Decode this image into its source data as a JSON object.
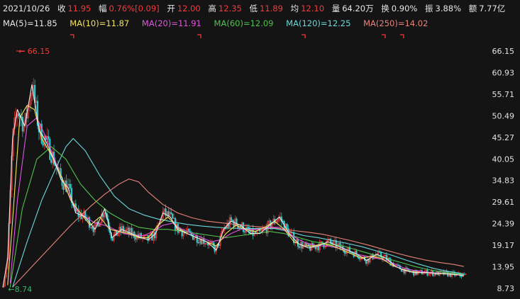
{
  "quote": {
    "date": "2021/10/26",
    "close_label": "收",
    "close": "11.95",
    "change_label": "幅",
    "change": "0.76%[0.09]",
    "open_label": "开",
    "open": "12.00",
    "high_label": "高",
    "high": "12.35",
    "low_label": "低",
    "low": "11.89",
    "avg_label": "均",
    "avg": "12.10",
    "volume_label": "量",
    "volume": "64.20万",
    "turnover_label": "换",
    "turnover": "0.90%",
    "amplitude_label": "振",
    "amplitude": "3.88%",
    "amount_label": "额",
    "amount": "7.77亿"
  },
  "ma_legend": [
    {
      "text": "MA(5)=11.85",
      "color": "#e8e8e8"
    },
    {
      "text": "MA(10)=11.87",
      "color": "#f2e35a"
    },
    {
      "text": "MA(20)=11.91",
      "color": "#e055e0"
    },
    {
      "text": "MA(60)=12.09",
      "color": "#4fc24f"
    },
    {
      "text": "MA(120)=12.25",
      "color": "#6ad8dc"
    },
    {
      "text": "MA(250)=14.02",
      "color": "#e8837a"
    }
  ],
  "colors": {
    "up": "#f23b3b",
    "down": "#30c8c8",
    "flat": "#e6e6e6",
    "background": "#141414",
    "accent": "#f23b3b",
    "low_marker": "#35b86b"
  },
  "chart_data": {
    "type": "line",
    "y_ticks": [
      "66.15",
      "60.93",
      "55.71",
      "50.49",
      "45.27",
      "40.05",
      "34.83",
      "29.61",
      "24.39",
      "19.17",
      "13.95",
      "8.73"
    ],
    "ylim": [
      8.73,
      66.15
    ],
    "grid": false,
    "max_annotation": {
      "label": "66.15",
      "x": 0.06,
      "y": 66.15
    },
    "min_annotation": {
      "label": "8.74",
      "x": 0.005,
      "y": 8.74
    },
    "event_markers": [
      0.143,
      0.405,
      0.62,
      0.785,
      0.823
    ],
    "series": [
      {
        "name": "MA(5)",
        "color": "#e8e8e8",
        "values": [
          [
            0,
            9.0
          ],
          [
            0.01,
            16
          ],
          [
            0.02,
            45
          ],
          [
            0.03,
            52
          ],
          [
            0.045,
            48
          ],
          [
            0.06,
            58
          ],
          [
            0.075,
            47
          ],
          [
            0.09,
            44
          ],
          [
            0.105,
            40
          ],
          [
            0.12,
            35
          ],
          [
            0.135,
            33
          ],
          [
            0.15,
            27
          ],
          [
            0.17,
            26
          ],
          [
            0.19,
            23
          ],
          [
            0.21,
            28
          ],
          [
            0.225,
            21
          ],
          [
            0.245,
            23
          ],
          [
            0.265,
            22
          ],
          [
            0.285,
            21
          ],
          [
            0.3,
            20.5
          ],
          [
            0.315,
            22
          ],
          [
            0.33,
            27
          ],
          [
            0.345,
            26
          ],
          [
            0.36,
            23
          ],
          [
            0.38,
            22
          ],
          [
            0.4,
            21
          ],
          [
            0.42,
            20
          ],
          [
            0.44,
            18
          ],
          [
            0.455,
            23
          ],
          [
            0.47,
            25
          ],
          [
            0.49,
            24
          ],
          [
            0.51,
            22
          ],
          [
            0.53,
            22
          ],
          [
            0.55,
            24
          ],
          [
            0.57,
            26
          ],
          [
            0.59,
            22
          ],
          [
            0.61,
            19.5
          ],
          [
            0.63,
            18.5
          ],
          [
            0.65,
            19
          ],
          [
            0.67,
            20
          ],
          [
            0.69,
            19
          ],
          [
            0.71,
            18
          ],
          [
            0.73,
            17
          ],
          [
            0.75,
            15.5
          ],
          [
            0.77,
            17
          ],
          [
            0.79,
            16
          ],
          [
            0.81,
            14
          ],
          [
            0.83,
            13
          ],
          [
            0.85,
            12.5
          ],
          [
            0.87,
            12.6
          ],
          [
            0.89,
            12.4
          ],
          [
            0.91,
            12.3
          ],
          [
            0.93,
            12.1
          ],
          [
            0.95,
            11.85
          ]
        ]
      },
      {
        "name": "MA(10)",
        "color": "#f2e35a",
        "values": [
          [
            0.01,
            9.5
          ],
          [
            0.02,
            25
          ],
          [
            0.035,
            50
          ],
          [
            0.05,
            53
          ],
          [
            0.065,
            52
          ],
          [
            0.08,
            45
          ],
          [
            0.1,
            41
          ],
          [
            0.12,
            36
          ],
          [
            0.14,
            30
          ],
          [
            0.16,
            27
          ],
          [
            0.18,
            24
          ],
          [
            0.2,
            26
          ],
          [
            0.22,
            23
          ],
          [
            0.24,
            22.5
          ],
          [
            0.26,
            22
          ],
          [
            0.28,
            21
          ],
          [
            0.3,
            21
          ],
          [
            0.32,
            24
          ],
          [
            0.34,
            26
          ],
          [
            0.36,
            23.5
          ],
          [
            0.38,
            22
          ],
          [
            0.4,
            21
          ],
          [
            0.42,
            20
          ],
          [
            0.44,
            19
          ],
          [
            0.46,
            22
          ],
          [
            0.48,
            24
          ],
          [
            0.5,
            23
          ],
          [
            0.52,
            22.5
          ],
          [
            0.54,
            23.5
          ],
          [
            0.56,
            25
          ],
          [
            0.58,
            23
          ],
          [
            0.6,
            20
          ],
          [
            0.62,
            19
          ],
          [
            0.64,
            19
          ],
          [
            0.66,
            19.5
          ],
          [
            0.68,
            19
          ],
          [
            0.7,
            18
          ],
          [
            0.72,
            17
          ],
          [
            0.74,
            16
          ],
          [
            0.76,
            16.5
          ],
          [
            0.78,
            16
          ],
          [
            0.8,
            14.5
          ],
          [
            0.82,
            13.5
          ],
          [
            0.84,
            12.8
          ],
          [
            0.86,
            12.6
          ],
          [
            0.88,
            12.5
          ],
          [
            0.9,
            12.3
          ],
          [
            0.92,
            12.2
          ],
          [
            0.95,
            11.87
          ]
        ]
      },
      {
        "name": "MA(20)",
        "color": "#e055e0",
        "values": [
          [
            0.015,
            10
          ],
          [
            0.03,
            30
          ],
          [
            0.05,
            48
          ],
          [
            0.07,
            50
          ],
          [
            0.09,
            45
          ],
          [
            0.11,
            39
          ],
          [
            0.13,
            33
          ],
          [
            0.15,
            28
          ],
          [
            0.17,
            26
          ],
          [
            0.19,
            24.5
          ],
          [
            0.21,
            24
          ],
          [
            0.23,
            23
          ],
          [
            0.25,
            22
          ],
          [
            0.27,
            21.5
          ],
          [
            0.29,
            21.5
          ],
          [
            0.31,
            22.5
          ],
          [
            0.33,
            24
          ],
          [
            0.35,
            24.5
          ],
          [
            0.37,
            23
          ],
          [
            0.39,
            22
          ],
          [
            0.41,
            21
          ],
          [
            0.43,
            20
          ],
          [
            0.45,
            20.5
          ],
          [
            0.47,
            22
          ],
          [
            0.49,
            23
          ],
          [
            0.51,
            23
          ],
          [
            0.53,
            23
          ],
          [
            0.55,
            23.5
          ],
          [
            0.57,
            23.5
          ],
          [
            0.59,
            22
          ],
          [
            0.61,
            20.5
          ],
          [
            0.63,
            19.5
          ],
          [
            0.65,
            19
          ],
          [
            0.67,
            19
          ],
          [
            0.69,
            18.5
          ],
          [
            0.71,
            18
          ],
          [
            0.73,
            17
          ],
          [
            0.75,
            16.5
          ],
          [
            0.77,
            16
          ],
          [
            0.79,
            15.5
          ],
          [
            0.81,
            14.5
          ],
          [
            0.83,
            13.5
          ],
          [
            0.85,
            13
          ],
          [
            0.87,
            12.7
          ],
          [
            0.89,
            12.5
          ],
          [
            0.91,
            12.3
          ],
          [
            0.95,
            11.91
          ]
        ]
      },
      {
        "name": "MA(60)",
        "color": "#4fc24f",
        "values": [
          [
            0.015,
            9
          ],
          [
            0.04,
            28
          ],
          [
            0.07,
            40
          ],
          [
            0.1,
            43
          ],
          [
            0.13,
            40
          ],
          [
            0.16,
            34
          ],
          [
            0.19,
            30
          ],
          [
            0.22,
            27
          ],
          [
            0.25,
            25
          ],
          [
            0.28,
            23.5
          ],
          [
            0.31,
            23
          ],
          [
            0.34,
            23
          ],
          [
            0.37,
            22.5
          ],
          [
            0.4,
            22
          ],
          [
            0.43,
            21.5
          ],
          [
            0.46,
            21
          ],
          [
            0.49,
            21.5
          ],
          [
            0.52,
            22
          ],
          [
            0.55,
            22.5
          ],
          [
            0.58,
            22
          ],
          [
            0.61,
            21
          ],
          [
            0.64,
            20
          ],
          [
            0.67,
            19.5
          ],
          [
            0.7,
            19
          ],
          [
            0.73,
            18
          ],
          [
            0.76,
            17
          ],
          [
            0.79,
            16
          ],
          [
            0.82,
            15
          ],
          [
            0.85,
            14
          ],
          [
            0.88,
            13.2
          ],
          [
            0.91,
            12.6
          ],
          [
            0.95,
            12.09
          ]
        ]
      },
      {
        "name": "MA(120)",
        "color": "#6ad8dc",
        "values": [
          [
            0.02,
            9
          ],
          [
            0.05,
            20
          ],
          [
            0.08,
            30
          ],
          [
            0.11,
            38
          ],
          [
            0.13,
            43
          ],
          [
            0.145,
            45
          ],
          [
            0.17,
            42
          ],
          [
            0.2,
            36
          ],
          [
            0.23,
            31
          ],
          [
            0.26,
            28
          ],
          [
            0.29,
            26.5
          ],
          [
            0.32,
            25.5
          ],
          [
            0.35,
            24.8
          ],
          [
            0.38,
            24.2
          ],
          [
            0.41,
            23.8
          ],
          [
            0.44,
            23.5
          ],
          [
            0.47,
            23.3
          ],
          [
            0.5,
            23.2
          ],
          [
            0.53,
            23.2
          ],
          [
            0.56,
            23.2
          ],
          [
            0.59,
            22.5
          ],
          [
            0.62,
            21.5
          ],
          [
            0.65,
            21
          ],
          [
            0.68,
            20.3
          ],
          [
            0.71,
            19.6
          ],
          [
            0.74,
            18.8
          ],
          [
            0.77,
            17.8
          ],
          [
            0.8,
            16.8
          ],
          [
            0.83,
            15.6
          ],
          [
            0.86,
            14.5
          ],
          [
            0.89,
            13.5
          ],
          [
            0.92,
            12.8
          ],
          [
            0.95,
            12.25
          ]
        ]
      },
      {
        "name": "MA(250)",
        "color": "#e8837a",
        "values": [
          [
            0.02,
            9
          ],
          [
            0.06,
            14
          ],
          [
            0.1,
            19
          ],
          [
            0.14,
            24
          ],
          [
            0.18,
            28.5
          ],
          [
            0.21,
            31.5
          ],
          [
            0.24,
            34
          ],
          [
            0.26,
            35.2
          ],
          [
            0.28,
            34.5
          ],
          [
            0.3,
            32
          ],
          [
            0.33,
            29
          ],
          [
            0.36,
            27
          ],
          [
            0.39,
            25.8
          ],
          [
            0.42,
            25
          ],
          [
            0.45,
            24.6
          ],
          [
            0.48,
            24.2
          ],
          [
            0.51,
            23.8
          ],
          [
            0.54,
            23.5
          ],
          [
            0.57,
            23.2
          ],
          [
            0.6,
            22.7
          ],
          [
            0.63,
            22.3
          ],
          [
            0.66,
            21.8
          ],
          [
            0.69,
            21
          ],
          [
            0.72,
            20.2
          ],
          [
            0.75,
            19.3
          ],
          [
            0.78,
            18.3
          ],
          [
            0.81,
            17.3
          ],
          [
            0.84,
            16.4
          ],
          [
            0.87,
            15.6
          ],
          [
            0.9,
            15
          ],
          [
            0.93,
            14.5
          ],
          [
            0.95,
            14.02
          ]
        ]
      }
    ]
  }
}
